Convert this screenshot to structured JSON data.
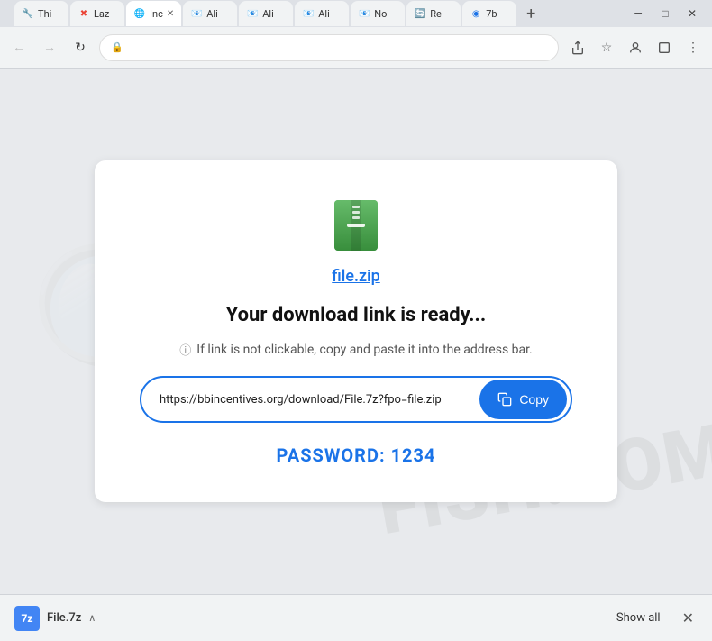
{
  "titlebar": {
    "tabs": [
      {
        "id": "tab1",
        "label": "Thi",
        "active": false,
        "favicon": "🔧"
      },
      {
        "id": "tab2",
        "label": "Laz",
        "active": false,
        "favicon": "✖"
      },
      {
        "id": "tab3",
        "label": "Inc",
        "active": true,
        "favicon": "🌐"
      },
      {
        "id": "tab4",
        "label": "Ali",
        "active": false,
        "favicon": "📧"
      },
      {
        "id": "tab5",
        "label": "Ali",
        "active": false,
        "favicon": "📧"
      },
      {
        "id": "tab6",
        "label": "Ali",
        "active": false,
        "favicon": "📧"
      },
      {
        "id": "tab7",
        "label": "No",
        "active": false,
        "favicon": "📧"
      },
      {
        "id": "tab8",
        "label": "Re",
        "active": false,
        "favicon": "🔄"
      },
      {
        "id": "tab9",
        "label": "7b",
        "active": false,
        "favicon": "🔵"
      }
    ],
    "new_tab_label": "+",
    "window_controls": {
      "minimize": "—",
      "maximize": "□",
      "close": "✕"
    }
  },
  "address_bar": {
    "url": "",
    "lock_icon": "🔒",
    "back_disabled": true,
    "forward_disabled": true
  },
  "page": {
    "file_name": "file.zip",
    "headline": "Your download link is ready...",
    "info_text": "If link is not clickable, copy and paste it into the address bar.",
    "download_url": "https://bbincentives.org/download/File.7z?fpo=file.zip",
    "copy_button_label": "Copy",
    "password_label": "PASSWORD: 1234",
    "watermark_text": "FISH.COM"
  },
  "download_bar": {
    "file_name": "File.7z",
    "expand_icon": "∧",
    "show_all_label": "Show all",
    "close_label": "✕"
  }
}
